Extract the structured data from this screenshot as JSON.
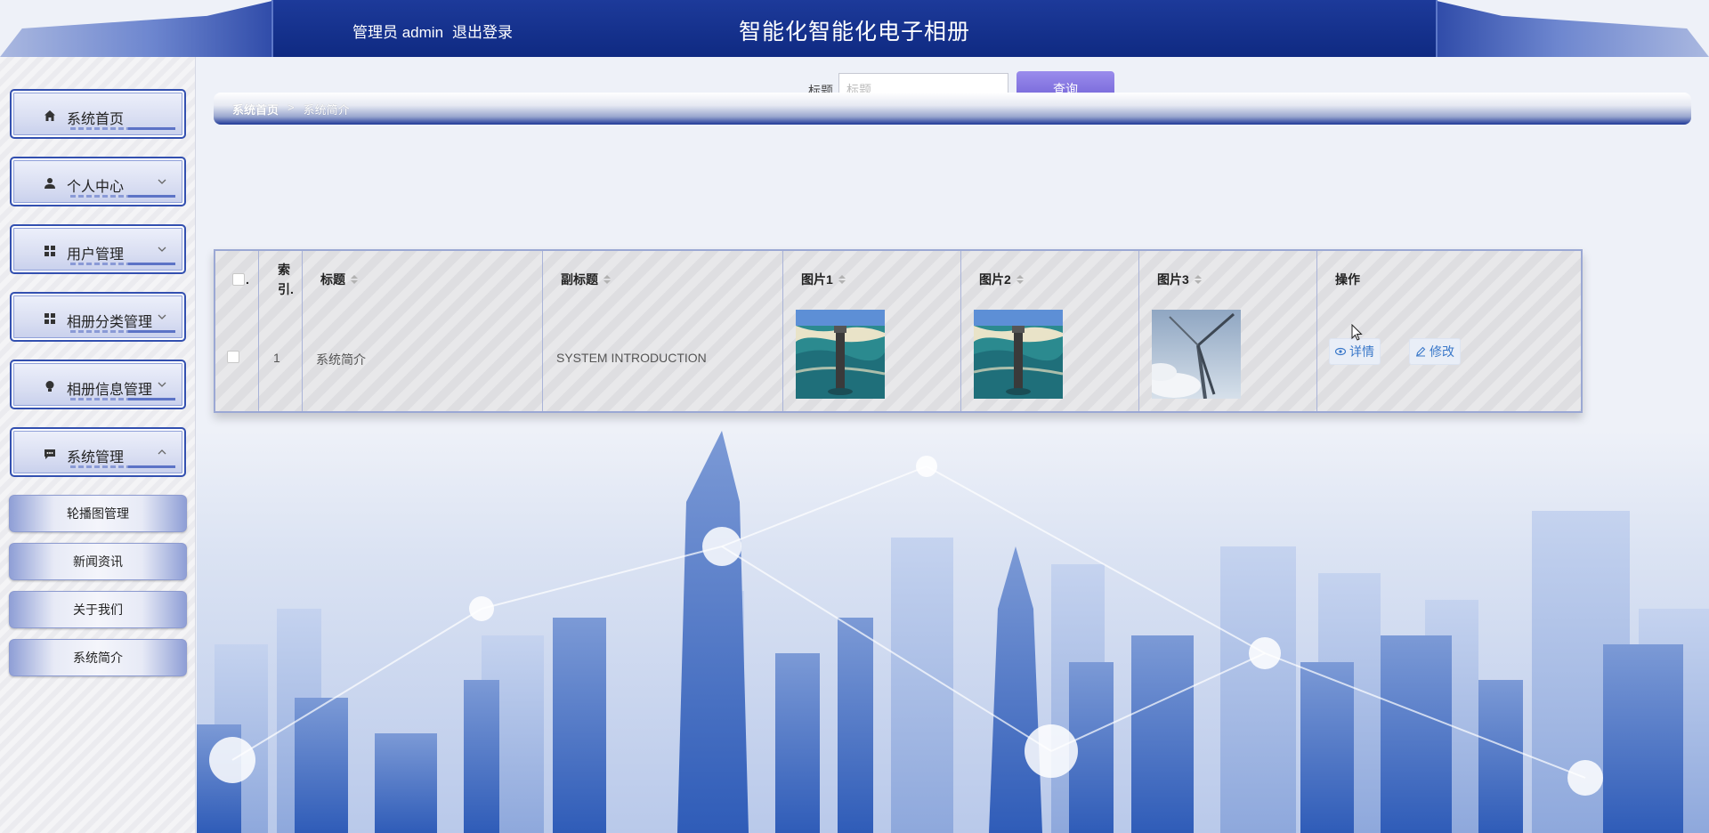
{
  "header": {
    "role_label": "管理员 admin",
    "logout_label": "退出登录",
    "title": "智能化智能化电子相册"
  },
  "sidebar": {
    "items": [
      {
        "label": "系统首页",
        "icon": "home-icon",
        "expandable": false
      },
      {
        "label": "个人中心",
        "icon": "user-icon",
        "expandable": true
      },
      {
        "label": "用户管理",
        "icon": "grid-icon",
        "expandable": true
      },
      {
        "label": "相册分类管理",
        "icon": "grid-icon",
        "expandable": true
      },
      {
        "label": "相册信息管理",
        "icon": "bulb-icon",
        "expandable": true
      },
      {
        "label": "系统管理",
        "icon": "chat-icon",
        "expandable": true,
        "expanded": true
      }
    ],
    "sub_items": [
      "轮播图管理",
      "新闻资讯",
      "关于我们",
      "系统简介"
    ]
  },
  "search": {
    "label": "标题",
    "placeholder": "标题",
    "value": "",
    "button_label": "查询"
  },
  "breadcrumb": {
    "home": "系统首页",
    "separator": ">",
    "current": "系统简介"
  },
  "table": {
    "columns": [
      {
        "key": "select",
        "label": "."
      },
      {
        "key": "index",
        "label": "索引."
      },
      {
        "key": "title",
        "label": "标题"
      },
      {
        "key": "subtitle",
        "label": "副标题"
      },
      {
        "key": "picture1",
        "label": "图片1"
      },
      {
        "key": "picture2",
        "label": "图片2"
      },
      {
        "key": "picture3",
        "label": "图片3"
      },
      {
        "key": "actions",
        "label": "操作"
      }
    ],
    "rows": [
      {
        "index": "1",
        "title": "系统简介",
        "subtitle": "SYSTEM INTRODUCTION",
        "picture1": "lighthouse-photo",
        "picture2": "lighthouse-photo",
        "picture3": "wind-turbine-photo"
      }
    ],
    "actions": {
      "detail_label": "详情",
      "edit_label": "修改"
    }
  },
  "colors": {
    "header_blue": "#0f2a82",
    "sidebar_border": "#3350b0",
    "button_purple": "#6b5bd3",
    "link_blue": "#3a78c9"
  }
}
